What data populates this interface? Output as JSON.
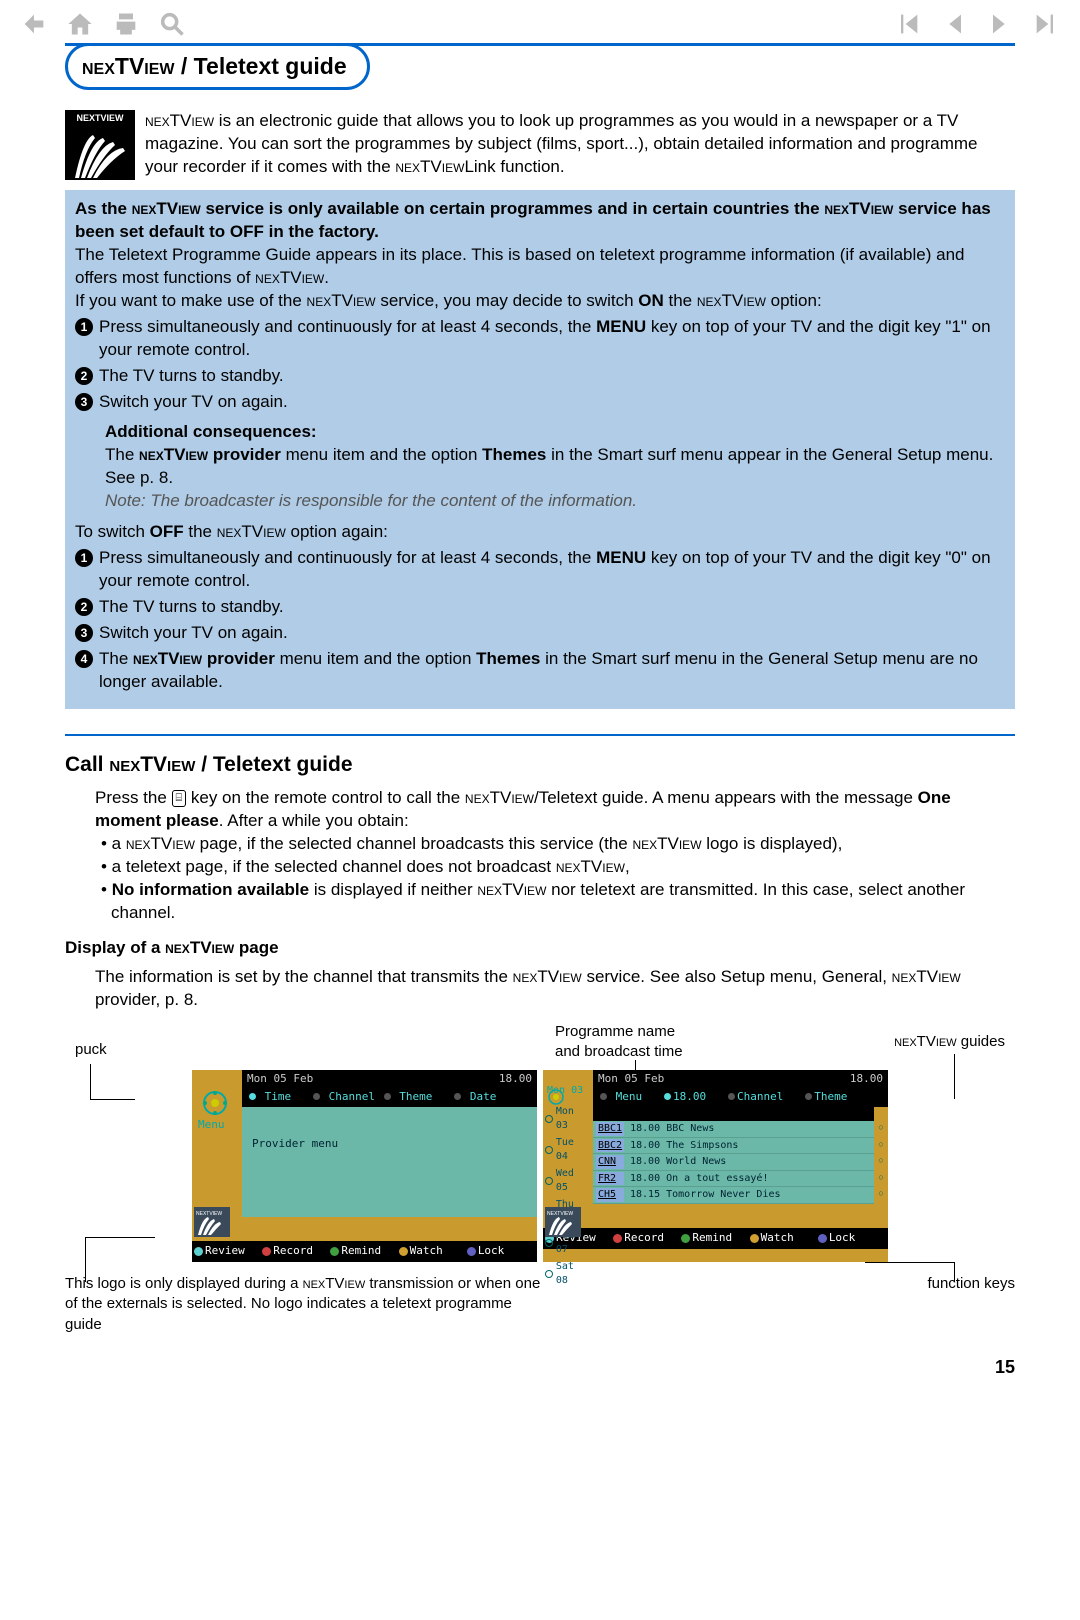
{
  "page_number": "15",
  "title": "NEXTVIEW / Teletext guide",
  "intro": "NEXTVIEW is an electronic guide that allows you to look up programmes as you would in a newspaper or a TV magazine. You can sort the programmes by subject (films, sport...), obtain detailed information and programme your recorder if it comes with the NEXTVIEWLink function.",
  "bluebox": {
    "lead_bold": "As the NEXTVIEW service is only available on certain programmes and in certain countries the NEXTVIEW service has been set default to OFF in the factory.",
    "p1": "The Teletext Programme Guide appears in its place. This is based on teletext programme information (if available) and offers most functions of NEXTVIEW.",
    "p2": "If you want to make use of the NEXTVIEW service, you may decide to switch ON the NEXTVIEW option:",
    "on_1": "Press simultaneously and continuously for at least 4 seconds, the MENU key on top of your TV and the digit key \"1\" on your remote control.",
    "on_2": "The TV turns to standby.",
    "on_3": "Switch your TV on again.",
    "additional_h": "Additional consequences:",
    "additional_p": "The NEXTVIEW provider menu item and the option Themes in the Smart surf menu appear in the General Setup menu. See p. 8.",
    "note": "Note: The broadcaster is responsible for the content of the information.",
    "off_intro": "To switch OFF the NEXTVIEW option again:",
    "off_1": "Press simultaneously and continuously for at least 4 seconds, the MENU key on top of your TV and the digit key \"0\" on your remote control.",
    "off_2": "The TV turns to standby.",
    "off_3": "Switch your TV on again.",
    "off_4": "The NEXTVIEW provider menu item and the option Themes in the Smart surf menu in the General Setup menu are no longer available."
  },
  "call_h": "Call NEXTVIEW / Teletext guide",
  "call_p1a": "Press the ",
  "call_p1b": " key on the remote control to call the NEXTVIEW/Teletext guide. A menu appears with the message One moment please. After a while you obtain:",
  "call_b1": "a NEXTVIEW page, if the selected channel broadcasts this service (the NEXTVIEW logo is displayed),",
  "call_b2": "a teletext page, if the selected channel does not broadcast NEXTVIEW,",
  "call_b3": "No information available is displayed if neither NEXTVIEW nor teletext are transmitted. In this case, select another channel.",
  "display_h": "Display of a NEXTVIEW page",
  "display_p": "The information is set by the channel that transmits the NEXTVIEW service. See also Setup menu, General, NEXTVIEW provider, p. 8.",
  "labels": {
    "puck": "puck",
    "progname": "Programme name\nand broadcast time",
    "guides": "NEXTVIEW guides",
    "logo_note": "This logo is only displayed during a NEXTVIEW transmission or when one of the externals is selected. No logo indicates a teletext programme guide",
    "fkeys": "function keys"
  },
  "screen1": {
    "date": "Mon 05 Feb",
    "time": "18.00",
    "menu_label": "Menu",
    "menu_items": [
      "Time",
      "Channel",
      "Theme",
      "Date"
    ],
    "body": "Provider menu",
    "footer": [
      "Review",
      "Record",
      "Remind",
      "Watch",
      "Lock"
    ],
    "footer_colors": [
      "#5dd0d0",
      "#d04040",
      "#40a040",
      "#d0a030",
      "#6060c0"
    ]
  },
  "screen2": {
    "date": "Mon 05 Feb",
    "time": "18.00",
    "left_label": "Mon 03",
    "menu_items": [
      "Menu",
      "18.00",
      "Channel",
      "Theme"
    ],
    "days": [
      "Mon 03",
      "Tue 04",
      "Wed 05",
      "Thu 06",
      "Fri 07",
      "Sat 08"
    ],
    "rows": [
      {
        "ch": "BBC1",
        "time": "18.00",
        "name": "BBC News"
      },
      {
        "ch": "BBC2",
        "time": "18.00",
        "name": "The Simpsons"
      },
      {
        "ch": "CNN",
        "time": "18.00",
        "name": "World News"
      },
      {
        "ch": "FR2",
        "time": "18.00",
        "name": "On a tout essayé!"
      },
      {
        "ch": "CH5",
        "time": "18.15",
        "name": "Tomorrow Never Dies"
      }
    ],
    "footer": [
      "Review",
      "Record",
      "Remind",
      "Watch",
      "Lock"
    ]
  }
}
